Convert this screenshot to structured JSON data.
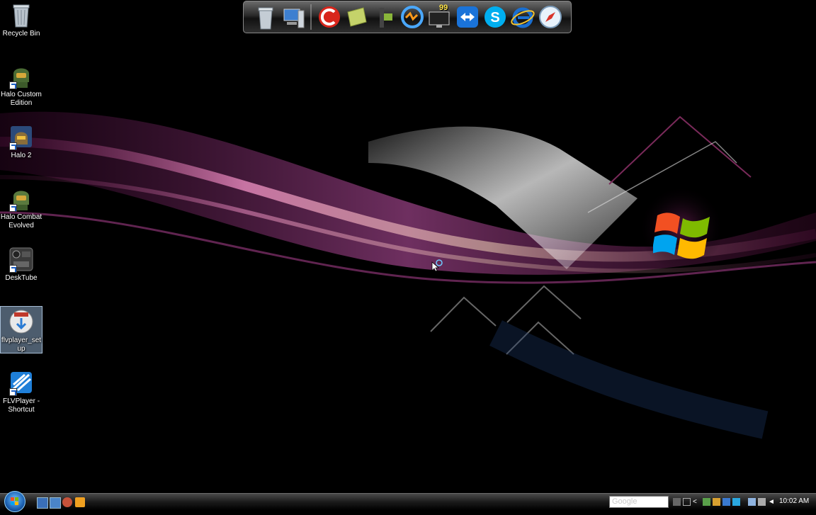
{
  "desktop": {
    "icons": [
      {
        "label": "Recycle Bin"
      },
      {
        "label": "Halo Custom Edition"
      },
      {
        "label": "Halo 2"
      },
      {
        "label": "Halo Combat Evolved"
      },
      {
        "label": "DeskTube"
      },
      {
        "label": "flvplayer_setup"
      },
      {
        "label": "FLVPlayer - Shortcut"
      }
    ]
  },
  "dock": {
    "items": [
      "recycle-bin-icon",
      "computer-icon",
      "ccleaner-icon",
      "notes-icon",
      "media-icon",
      "sync-icon",
      "monitor-icon",
      "teamviewer-icon",
      "skype-icon",
      "internet-explorer-icon",
      "safari-icon"
    ],
    "badge": "99"
  },
  "taskbar": {
    "search_placeholder": "Google",
    "clock": "10:02 AM"
  },
  "colors": {
    "accent": "#1b5fb0",
    "taskbar": "#1b1b1b"
  }
}
